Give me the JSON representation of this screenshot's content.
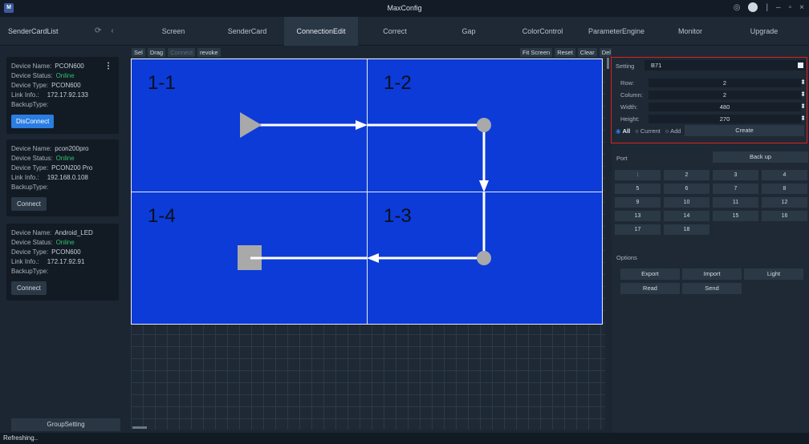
{
  "window": {
    "title": "MaxConfig",
    "logo_text": "M"
  },
  "sidebar": {
    "title": "SenderCardList",
    "devices": [
      {
        "name_label": "Device Name:",
        "name": "PCON600",
        "status_label": "Device Status:",
        "status": "Online",
        "type_label": "Device Type:",
        "type": "PCON600",
        "link_label": "Link Info.:",
        "link": "172.17.92.133",
        "backup_label": "BackupType:",
        "button": "DisConnect"
      },
      {
        "name_label": "Device Name:",
        "name": "pcon200pro",
        "status_label": "Device Status:",
        "status": "Online",
        "type_label": "Device Type:",
        "type": "PCON200 Pro",
        "link_label": "Link Info.:",
        "link": "192.168.0.108",
        "backup_label": "BackupType:",
        "button": "Connect"
      },
      {
        "name_label": "Device Name:",
        "name": "Android_LED",
        "status_label": "Device Status:",
        "status": "Online",
        "type_label": "Device Type:",
        "type": "PCON600",
        "link_label": "Link Info.:",
        "link": "172.17.92.91",
        "backup_label": "BackupType:",
        "button": "Connect"
      }
    ],
    "group_setting": "GroupSetting"
  },
  "tabs": [
    "Screen",
    "SenderCard",
    "ConnectionEdit",
    "Correct",
    "Gap",
    "ColorControl",
    "ParameterEngine",
    "Monitor",
    "Upgrade"
  ],
  "active_tab": "ConnectionEdit",
  "toolbar_left": [
    {
      "label": "Sel",
      "enabled": true
    },
    {
      "label": "Drag",
      "enabled": true
    },
    {
      "label": "Connect",
      "enabled": false
    },
    {
      "label": "revoke",
      "enabled": true
    }
  ],
  "toolbar_right": [
    "Fit Screen",
    "Reset",
    "Clear",
    "Del"
  ],
  "cells": [
    "1-1",
    "1-2",
    "1-3",
    "1-4"
  ],
  "setting": {
    "label": "Setting",
    "value": "B71",
    "row_label": "Row:",
    "row": "2",
    "column_label": "Column:",
    "column": "2",
    "width_label": "Width:",
    "width": "480",
    "height_label": "Height:",
    "height": "270",
    "radio_all": "All",
    "radio_current": "Current",
    "radio_add": "Add",
    "create": "Create"
  },
  "port": {
    "label": "Port",
    "backup": "Back up",
    "ports": [
      "1",
      "2",
      "3",
      "4",
      "5",
      "6",
      "7",
      "8",
      "9",
      "10",
      "11",
      "12",
      "13",
      "14",
      "15",
      "16",
      "17",
      "18"
    ]
  },
  "options": {
    "label": "Options",
    "export": "Export",
    "import": "Import",
    "light": "Light",
    "read": "Read",
    "send": "Send"
  },
  "status": "Refreshing..",
  "colors": {
    "screen_blue": "#0c3bd8",
    "accent": "#2a7de1",
    "online": "#2ec16c",
    "highlight_border": "#e0201f"
  }
}
